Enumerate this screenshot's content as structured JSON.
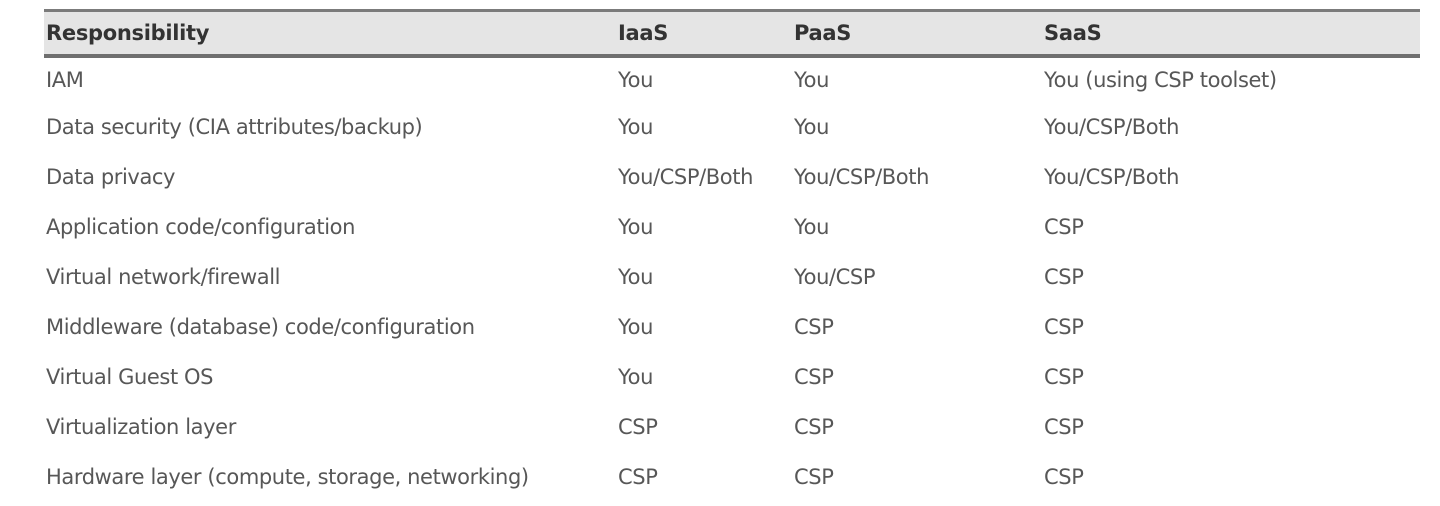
{
  "table": {
    "headers": [
      "Responsibility",
      "IaaS",
      "PaaS",
      "SaaS"
    ],
    "rows": [
      [
        "IAM",
        "You",
        "You",
        "You (using CSP toolset)"
      ],
      [
        "Data security (CIA attributes/backup)",
        "You",
        "You",
        "You/CSP/Both"
      ],
      [
        "Data privacy",
        "You/CSP/Both",
        "You/CSP/Both",
        "You/CSP/Both"
      ],
      [
        "Application code/configuration",
        "You",
        "You",
        "CSP"
      ],
      [
        "Virtual network/firewall",
        "You",
        "You/CSP",
        "CSP"
      ],
      [
        "Middleware (database) code/configuration",
        "You",
        "CSP",
        "CSP"
      ],
      [
        "Virtual Guest OS",
        "You",
        "CSP",
        "CSP"
      ],
      [
        "Virtualization layer",
        "CSP",
        "CSP",
        "CSP"
      ],
      [
        "Hardware layer (compute, storage, networking)",
        "CSP",
        "CSP",
        "CSP"
      ]
    ]
  },
  "colors": {
    "header_background": "#e5e5e5",
    "header_border": "#7b7b7b",
    "header_text": "#333333",
    "body_text": "#575757"
  }
}
